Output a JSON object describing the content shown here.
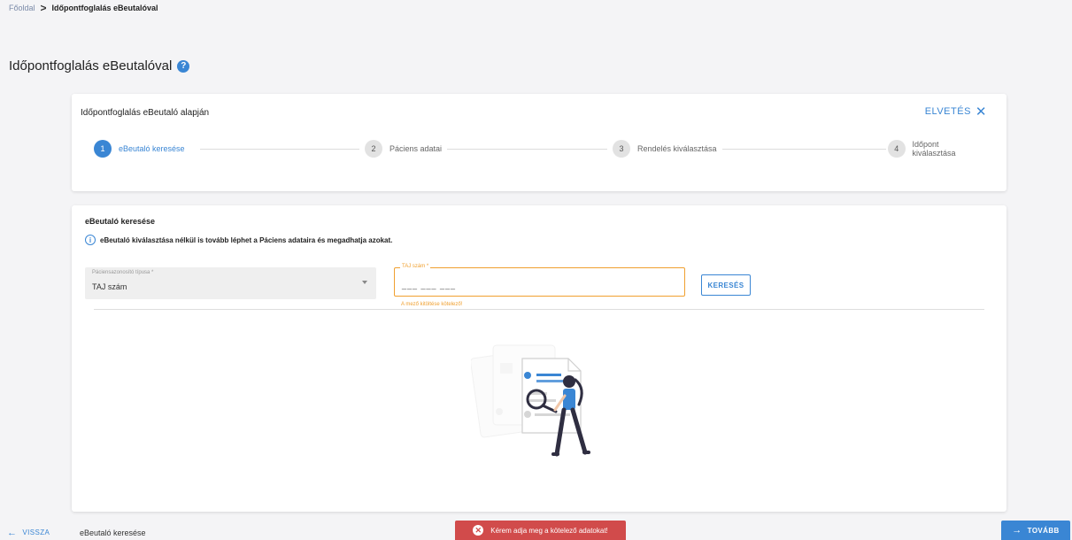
{
  "breadcrumb": {
    "home": "Főoldal",
    "separator": ">",
    "current": "Időpontfoglalás eBeutalóval"
  },
  "page": {
    "title": "Időpontfoglalás eBeutalóval",
    "help_icon": "question-circle-icon"
  },
  "stepper": {
    "title": "Időpontfoglalás eBeutaló alapján",
    "discard_label": "ELVETÉS",
    "steps": [
      {
        "number": "1",
        "label": "eBeutaló keresése",
        "active": true
      },
      {
        "number": "2",
        "label": "Páciens adatai",
        "active": false
      },
      {
        "number": "3",
        "label": "Rendelés kiválasztása",
        "active": false
      },
      {
        "number": "4",
        "label": "Időpont kiválasztása",
        "active": false
      }
    ]
  },
  "search": {
    "title": "eBeutaló keresése",
    "info": "eBeutaló kiválasztása nélkül is tovább léphet a Páciens adataira és megadhatja azokat.",
    "id_type_label": "Páciensazonosító típusa *",
    "id_type_value": "TAJ szám",
    "taj_label": "TAJ szám *",
    "taj_mask": "___ ___ ___",
    "taj_error": "A mező kitöltése kötelező!",
    "search_button": "KERESÉS"
  },
  "footer": {
    "back_label": "VISSZA",
    "current_step": "eBeutaló keresése",
    "toast_message": "Kérem adja meg a kötelező adatokat!",
    "next_label": "TOVÁBB"
  },
  "colors": {
    "accent": "#3a86d4",
    "warning": "#f0a030",
    "error": "#d14b4b"
  }
}
